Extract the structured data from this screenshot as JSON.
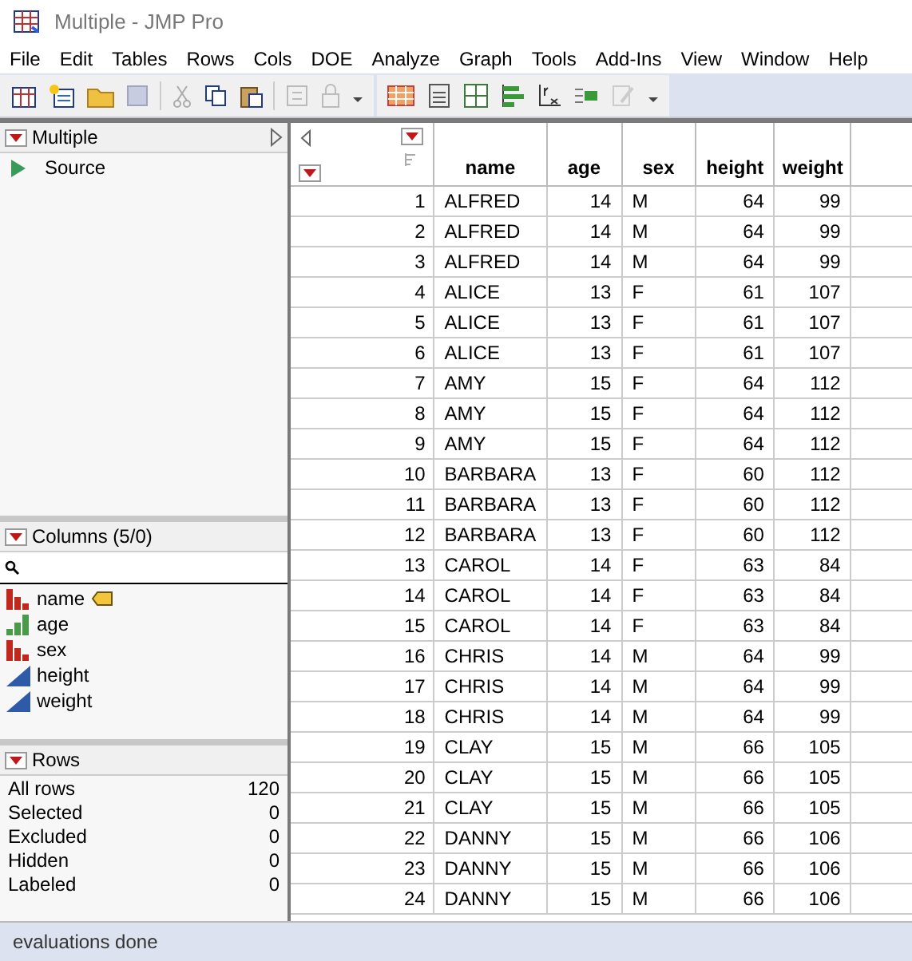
{
  "window": {
    "title": "Multiple - JMP Pro"
  },
  "menu": [
    "File",
    "Edit",
    "Tables",
    "Rows",
    "Cols",
    "DOE",
    "Analyze",
    "Graph",
    "Tools",
    "Add-Ins",
    "View",
    "Window",
    "Help"
  ],
  "tables_panel": {
    "title": "Multiple",
    "items": [
      "Source"
    ]
  },
  "columns_panel": {
    "title": "Columns (5/0)",
    "columns": [
      {
        "name": "name",
        "kind": "nominal",
        "labeled": true
      },
      {
        "name": "age",
        "kind": "ordinal",
        "labeled": false
      },
      {
        "name": "sex",
        "kind": "nominal",
        "labeled": false
      },
      {
        "name": "height",
        "kind": "continuous",
        "labeled": false
      },
      {
        "name": "weight",
        "kind": "continuous",
        "labeled": false
      }
    ]
  },
  "rows_panel": {
    "title": "Rows",
    "items": [
      {
        "label": "All rows",
        "value": "120"
      },
      {
        "label": "Selected",
        "value": "0"
      },
      {
        "label": "Excluded",
        "value": "0"
      },
      {
        "label": "Hidden",
        "value": "0"
      },
      {
        "label": "Labeled",
        "value": "0"
      }
    ]
  },
  "table": {
    "columns": [
      "",
      "name",
      "age",
      "sex",
      "height",
      "weight"
    ],
    "rows": [
      [
        "1",
        "ALFRED",
        "14",
        "M",
        "64",
        "99"
      ],
      [
        "2",
        "ALFRED",
        "14",
        "M",
        "64",
        "99"
      ],
      [
        "3",
        "ALFRED",
        "14",
        "M",
        "64",
        "99"
      ],
      [
        "4",
        "ALICE",
        "13",
        "F",
        "61",
        "107"
      ],
      [
        "5",
        "ALICE",
        "13",
        "F",
        "61",
        "107"
      ],
      [
        "6",
        "ALICE",
        "13",
        "F",
        "61",
        "107"
      ],
      [
        "7",
        "AMY",
        "15",
        "F",
        "64",
        "112"
      ],
      [
        "8",
        "AMY",
        "15",
        "F",
        "64",
        "112"
      ],
      [
        "9",
        "AMY",
        "15",
        "F",
        "64",
        "112"
      ],
      [
        "10",
        "BARBARA",
        "13",
        "F",
        "60",
        "112"
      ],
      [
        "11",
        "BARBARA",
        "13",
        "F",
        "60",
        "112"
      ],
      [
        "12",
        "BARBARA",
        "13",
        "F",
        "60",
        "112"
      ],
      [
        "13",
        "CAROL",
        "14",
        "F",
        "63",
        "84"
      ],
      [
        "14",
        "CAROL",
        "14",
        "F",
        "63",
        "84"
      ],
      [
        "15",
        "CAROL",
        "14",
        "F",
        "63",
        "84"
      ],
      [
        "16",
        "CHRIS",
        "14",
        "M",
        "64",
        "99"
      ],
      [
        "17",
        "CHRIS",
        "14",
        "M",
        "64",
        "99"
      ],
      [
        "18",
        "CHRIS",
        "14",
        "M",
        "64",
        "99"
      ],
      [
        "19",
        "CLAY",
        "15",
        "M",
        "66",
        "105"
      ],
      [
        "20",
        "CLAY",
        "15",
        "M",
        "66",
        "105"
      ],
      [
        "21",
        "CLAY",
        "15",
        "M",
        "66",
        "105"
      ],
      [
        "22",
        "DANNY",
        "15",
        "M",
        "66",
        "106"
      ],
      [
        "23",
        "DANNY",
        "15",
        "M",
        "66",
        "106"
      ],
      [
        "24",
        "DANNY",
        "15",
        "M",
        "66",
        "106"
      ]
    ]
  },
  "status_bar": "evaluations done"
}
